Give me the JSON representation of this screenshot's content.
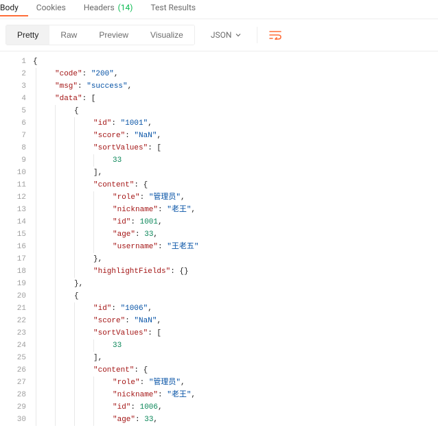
{
  "tabs": {
    "body": "Body",
    "cookies": "Cookies",
    "headers": "Headers",
    "headers_count": "(14)",
    "test_results": "Test Results"
  },
  "toolbar": {
    "pretty": "Pretty",
    "raw": "Raw",
    "preview": "Preview",
    "visualize": "Visualize",
    "format": "JSON"
  },
  "code_lines": [
    [
      {
        "t": "p",
        "v": "{"
      }
    ],
    [
      {
        "t": "g"
      },
      {
        "t": "key",
        "v": "\"code\""
      },
      {
        "t": "p",
        "v": ": "
      },
      {
        "t": "str",
        "v": "\"200\""
      },
      {
        "t": "p",
        "v": ","
      }
    ],
    [
      {
        "t": "g"
      },
      {
        "t": "key",
        "v": "\"msg\""
      },
      {
        "t": "p",
        "v": ": "
      },
      {
        "t": "str",
        "v": "\"success\""
      },
      {
        "t": "p",
        "v": ","
      }
    ],
    [
      {
        "t": "g"
      },
      {
        "t": "key",
        "v": "\"data\""
      },
      {
        "t": "p",
        "v": ": ["
      }
    ],
    [
      {
        "t": "g"
      },
      {
        "t": "g"
      },
      {
        "t": "p",
        "v": "{"
      }
    ],
    [
      {
        "t": "g"
      },
      {
        "t": "g"
      },
      {
        "t": "g"
      },
      {
        "t": "key",
        "v": "\"id\""
      },
      {
        "t": "p",
        "v": ": "
      },
      {
        "t": "str",
        "v": "\"1001\""
      },
      {
        "t": "p",
        "v": ","
      }
    ],
    [
      {
        "t": "g"
      },
      {
        "t": "g"
      },
      {
        "t": "g"
      },
      {
        "t": "key",
        "v": "\"score\""
      },
      {
        "t": "p",
        "v": ": "
      },
      {
        "t": "str",
        "v": "\"NaN\""
      },
      {
        "t": "p",
        "v": ","
      }
    ],
    [
      {
        "t": "g"
      },
      {
        "t": "g"
      },
      {
        "t": "g"
      },
      {
        "t": "key",
        "v": "\"sortValues\""
      },
      {
        "t": "p",
        "v": ": ["
      }
    ],
    [
      {
        "t": "g"
      },
      {
        "t": "g"
      },
      {
        "t": "g"
      },
      {
        "t": "g"
      },
      {
        "t": "num",
        "v": "33"
      }
    ],
    [
      {
        "t": "g"
      },
      {
        "t": "g"
      },
      {
        "t": "g"
      },
      {
        "t": "p",
        "v": "],"
      }
    ],
    [
      {
        "t": "g"
      },
      {
        "t": "g"
      },
      {
        "t": "g"
      },
      {
        "t": "key",
        "v": "\"content\""
      },
      {
        "t": "p",
        "v": ": {"
      }
    ],
    [
      {
        "t": "g"
      },
      {
        "t": "g"
      },
      {
        "t": "g"
      },
      {
        "t": "g"
      },
      {
        "t": "key",
        "v": "\"role\""
      },
      {
        "t": "p",
        "v": ": "
      },
      {
        "t": "str",
        "v": "\"管理员\""
      },
      {
        "t": "p",
        "v": ","
      }
    ],
    [
      {
        "t": "g"
      },
      {
        "t": "g"
      },
      {
        "t": "g"
      },
      {
        "t": "g"
      },
      {
        "t": "key",
        "v": "\"nickname\""
      },
      {
        "t": "p",
        "v": ": "
      },
      {
        "t": "str",
        "v": "\"老王\""
      },
      {
        "t": "p",
        "v": ","
      }
    ],
    [
      {
        "t": "g"
      },
      {
        "t": "g"
      },
      {
        "t": "g"
      },
      {
        "t": "g"
      },
      {
        "t": "key",
        "v": "\"id\""
      },
      {
        "t": "p",
        "v": ": "
      },
      {
        "t": "num",
        "v": "1001"
      },
      {
        "t": "p",
        "v": ","
      }
    ],
    [
      {
        "t": "g"
      },
      {
        "t": "g"
      },
      {
        "t": "g"
      },
      {
        "t": "g"
      },
      {
        "t": "key",
        "v": "\"age\""
      },
      {
        "t": "p",
        "v": ": "
      },
      {
        "t": "num",
        "v": "33"
      },
      {
        "t": "p",
        "v": ","
      }
    ],
    [
      {
        "t": "g"
      },
      {
        "t": "g"
      },
      {
        "t": "g"
      },
      {
        "t": "g"
      },
      {
        "t": "key",
        "v": "\"username\""
      },
      {
        "t": "p",
        "v": ": "
      },
      {
        "t": "str",
        "v": "\"王老五\""
      }
    ],
    [
      {
        "t": "g"
      },
      {
        "t": "g"
      },
      {
        "t": "g"
      },
      {
        "t": "p",
        "v": "},"
      }
    ],
    [
      {
        "t": "g"
      },
      {
        "t": "g"
      },
      {
        "t": "g"
      },
      {
        "t": "key",
        "v": "\"highlightFields\""
      },
      {
        "t": "p",
        "v": ": {}"
      }
    ],
    [
      {
        "t": "g"
      },
      {
        "t": "g"
      },
      {
        "t": "p",
        "v": "},"
      }
    ],
    [
      {
        "t": "g"
      },
      {
        "t": "g"
      },
      {
        "t": "p",
        "v": "{"
      }
    ],
    [
      {
        "t": "g"
      },
      {
        "t": "g"
      },
      {
        "t": "g"
      },
      {
        "t": "key",
        "v": "\"id\""
      },
      {
        "t": "p",
        "v": ": "
      },
      {
        "t": "str",
        "v": "\"1006\""
      },
      {
        "t": "p",
        "v": ","
      }
    ],
    [
      {
        "t": "g"
      },
      {
        "t": "g"
      },
      {
        "t": "g"
      },
      {
        "t": "key",
        "v": "\"score\""
      },
      {
        "t": "p",
        "v": ": "
      },
      {
        "t": "str",
        "v": "\"NaN\""
      },
      {
        "t": "p",
        "v": ","
      }
    ],
    [
      {
        "t": "g"
      },
      {
        "t": "g"
      },
      {
        "t": "g"
      },
      {
        "t": "key",
        "v": "\"sortValues\""
      },
      {
        "t": "p",
        "v": ": ["
      }
    ],
    [
      {
        "t": "g"
      },
      {
        "t": "g"
      },
      {
        "t": "g"
      },
      {
        "t": "g"
      },
      {
        "t": "num",
        "v": "33"
      }
    ],
    [
      {
        "t": "g"
      },
      {
        "t": "g"
      },
      {
        "t": "g"
      },
      {
        "t": "p",
        "v": "],"
      }
    ],
    [
      {
        "t": "g"
      },
      {
        "t": "g"
      },
      {
        "t": "g"
      },
      {
        "t": "key",
        "v": "\"content\""
      },
      {
        "t": "p",
        "v": ": {"
      }
    ],
    [
      {
        "t": "g"
      },
      {
        "t": "g"
      },
      {
        "t": "g"
      },
      {
        "t": "g"
      },
      {
        "t": "key",
        "v": "\"role\""
      },
      {
        "t": "p",
        "v": ": "
      },
      {
        "t": "str",
        "v": "\"管理员\""
      },
      {
        "t": "p",
        "v": ","
      }
    ],
    [
      {
        "t": "g"
      },
      {
        "t": "g"
      },
      {
        "t": "g"
      },
      {
        "t": "g"
      },
      {
        "t": "key",
        "v": "\"nickname\""
      },
      {
        "t": "p",
        "v": ": "
      },
      {
        "t": "str",
        "v": "\"老王\""
      },
      {
        "t": "p",
        "v": ","
      }
    ],
    [
      {
        "t": "g"
      },
      {
        "t": "g"
      },
      {
        "t": "g"
      },
      {
        "t": "g"
      },
      {
        "t": "key",
        "v": "\"id\""
      },
      {
        "t": "p",
        "v": ": "
      },
      {
        "t": "num",
        "v": "1006"
      },
      {
        "t": "p",
        "v": ","
      }
    ],
    [
      {
        "t": "g"
      },
      {
        "t": "g"
      },
      {
        "t": "g"
      },
      {
        "t": "g"
      },
      {
        "t": "key",
        "v": "\"age\""
      },
      {
        "t": "p",
        "v": ": "
      },
      {
        "t": "num",
        "v": "33"
      },
      {
        "t": "p",
        "v": ","
      }
    ]
  ]
}
